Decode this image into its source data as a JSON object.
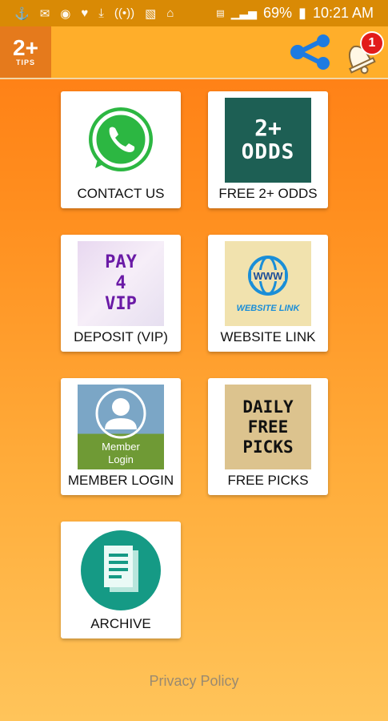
{
  "status_bar": {
    "battery": "69%",
    "time": "10:21 AM"
  },
  "app_bar": {
    "logo_text": "2+",
    "logo_sub": "TIPS",
    "notification_count": "1"
  },
  "tiles": [
    {
      "label": "CONTACT US"
    },
    {
      "label": "FREE 2+ ODDS",
      "image_text_1": "2+",
      "image_text_2": "ODDS"
    },
    {
      "label": "DEPOSIT (VIP)",
      "image_text_1": "PAY",
      "image_text_2": "4",
      "image_text_3": "VIP"
    },
    {
      "label": "WEBSITE LINK",
      "image_text_1": "WWW",
      "image_text_2": "WEBSITE LINK"
    },
    {
      "label": "MEMBER LOGIN",
      "image_text_1": "Member",
      "image_text_2": "Login"
    },
    {
      "label": "FREE PICKS",
      "image_text_1": "DAILY",
      "image_text_2": "FREE",
      "image_text_3": "PICKS"
    },
    {
      "label": "ARCHIVE"
    }
  ],
  "footer": {
    "privacy_link": "Privacy Policy"
  },
  "colors": {
    "orange_top": "#ff7a12",
    "orange_bottom": "#ffc45a",
    "appbar": "#ffae2a",
    "share_blue": "#1e7be0",
    "badge_red": "#e21b1b"
  }
}
